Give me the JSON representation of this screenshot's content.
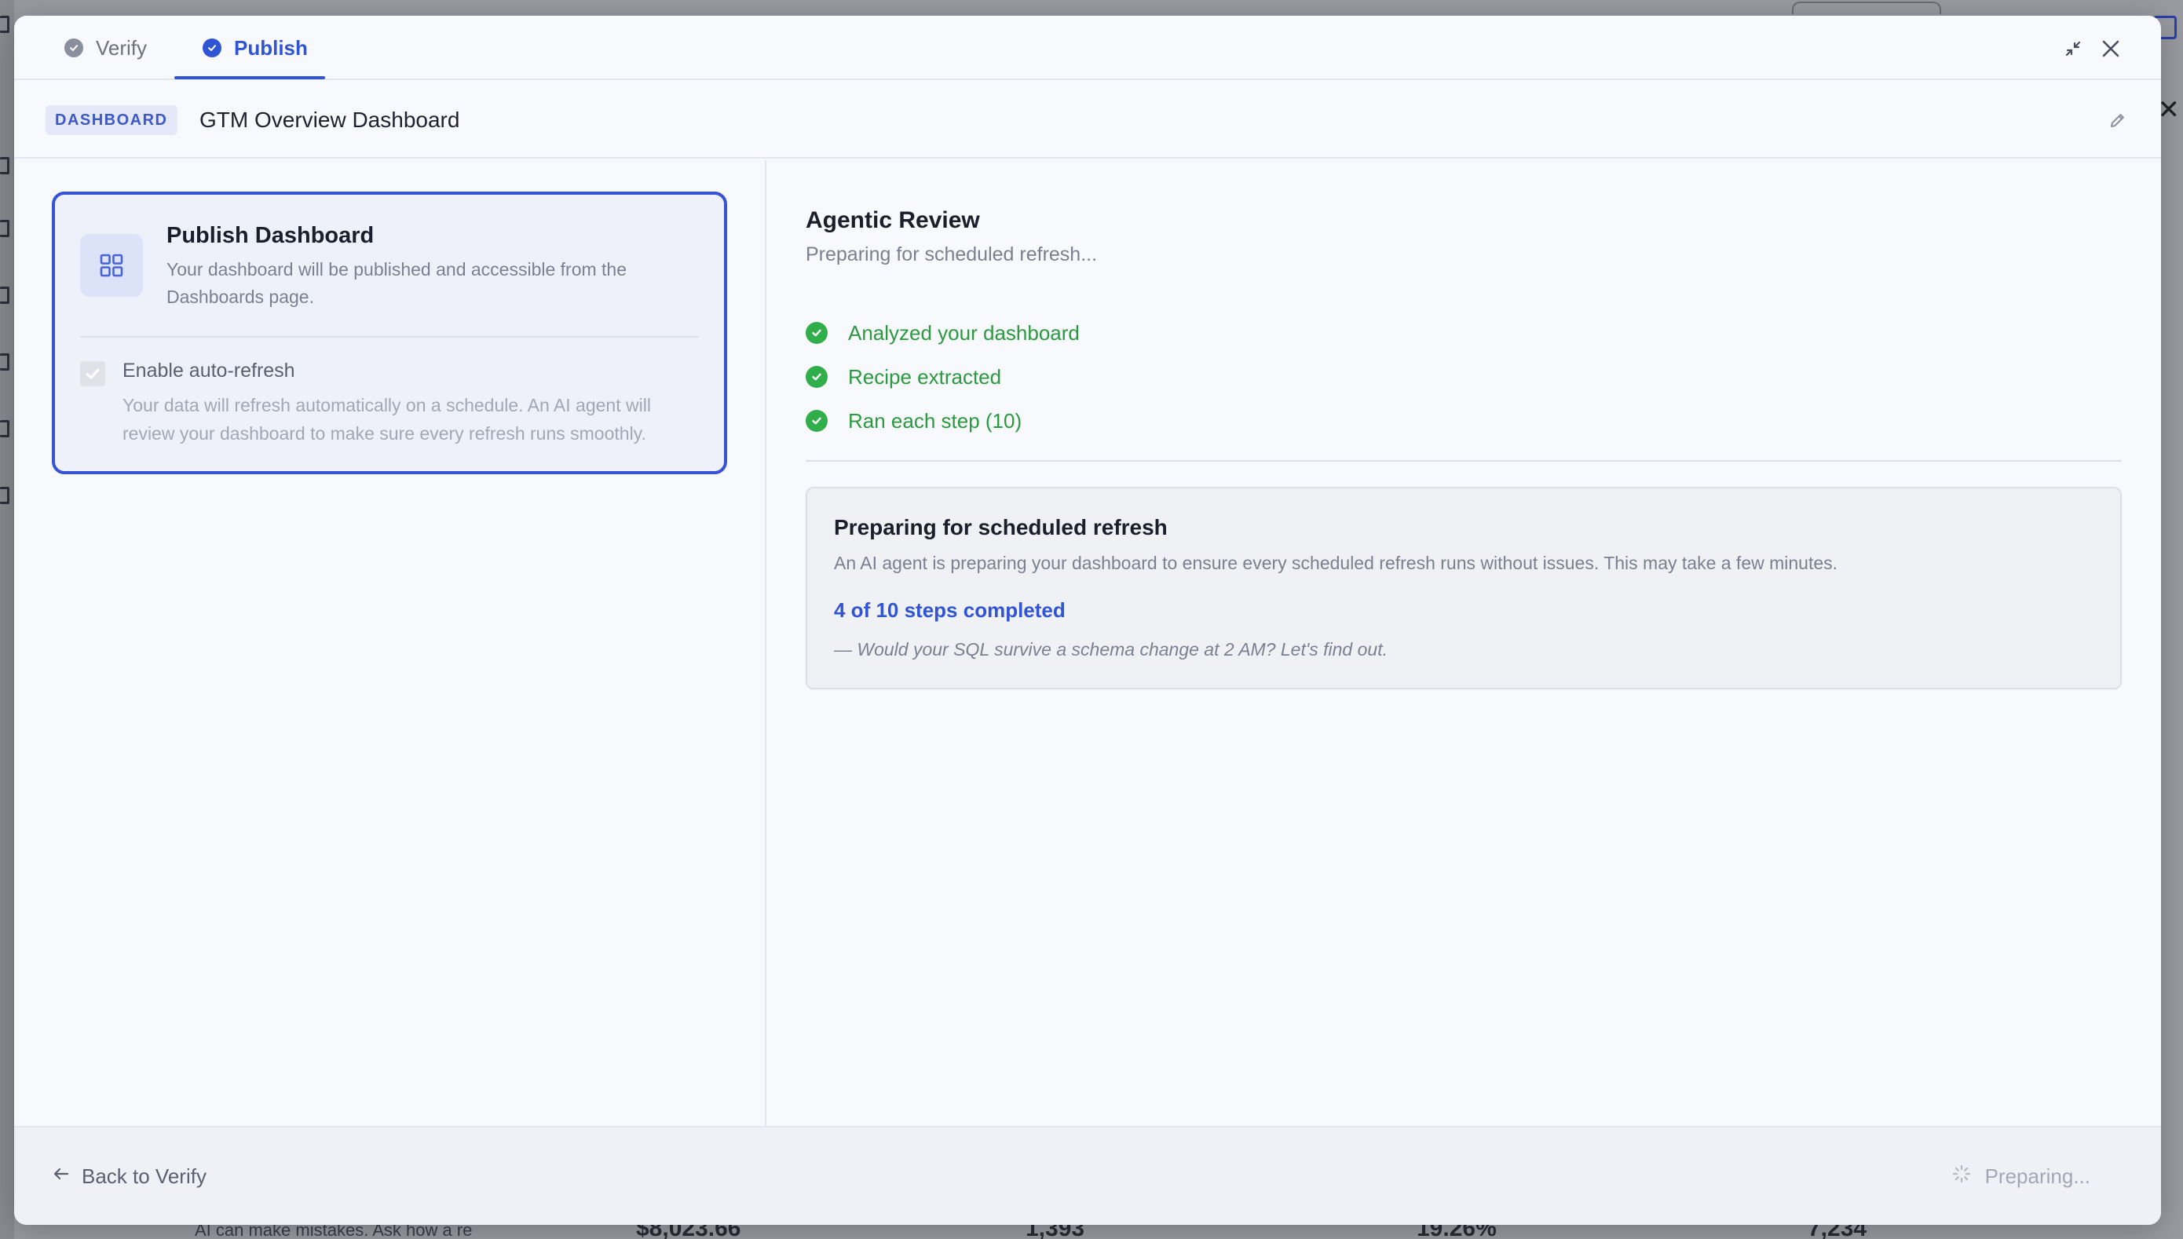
{
  "background": {
    "footer_note": "AI can make mistakes. Ask how a re",
    "stats": [
      "$8,023.66",
      "1,393",
      "19.26%",
      "7,234"
    ]
  },
  "tabs": {
    "verify": "Verify",
    "publish": "Publish"
  },
  "header": {
    "badge": "DASHBOARD",
    "title": "GTM Overview Dashboard"
  },
  "publish_card": {
    "title": "Publish Dashboard",
    "description": "Your dashboard will be published and accessible from the Dashboards page.",
    "auto_refresh_label": "Enable auto-refresh",
    "auto_refresh_description": "Your data will refresh automatically on a schedule. An AI agent will review your dashboard to make sure every refresh runs smoothly."
  },
  "review": {
    "title": "Agentic Review",
    "subtitle": "Preparing for scheduled refresh...",
    "steps": [
      "Analyzed your dashboard",
      "Recipe extracted",
      "Ran each step (10)"
    ]
  },
  "status": {
    "title": "Preparing for scheduled refresh",
    "description": "An AI agent is preparing your dashboard to ensure every scheduled refresh runs without issues. This may take a few minutes.",
    "progress": "4 of 10 steps completed",
    "quote": "— Would your SQL survive a schema change at 2 AM? Let's find out."
  },
  "footer": {
    "back_label": "Back to Verify",
    "preparing_label": "Preparing..."
  },
  "colors": {
    "accent": "#2f55d4",
    "success": "#2fae4a",
    "muted": "#7b8090"
  }
}
